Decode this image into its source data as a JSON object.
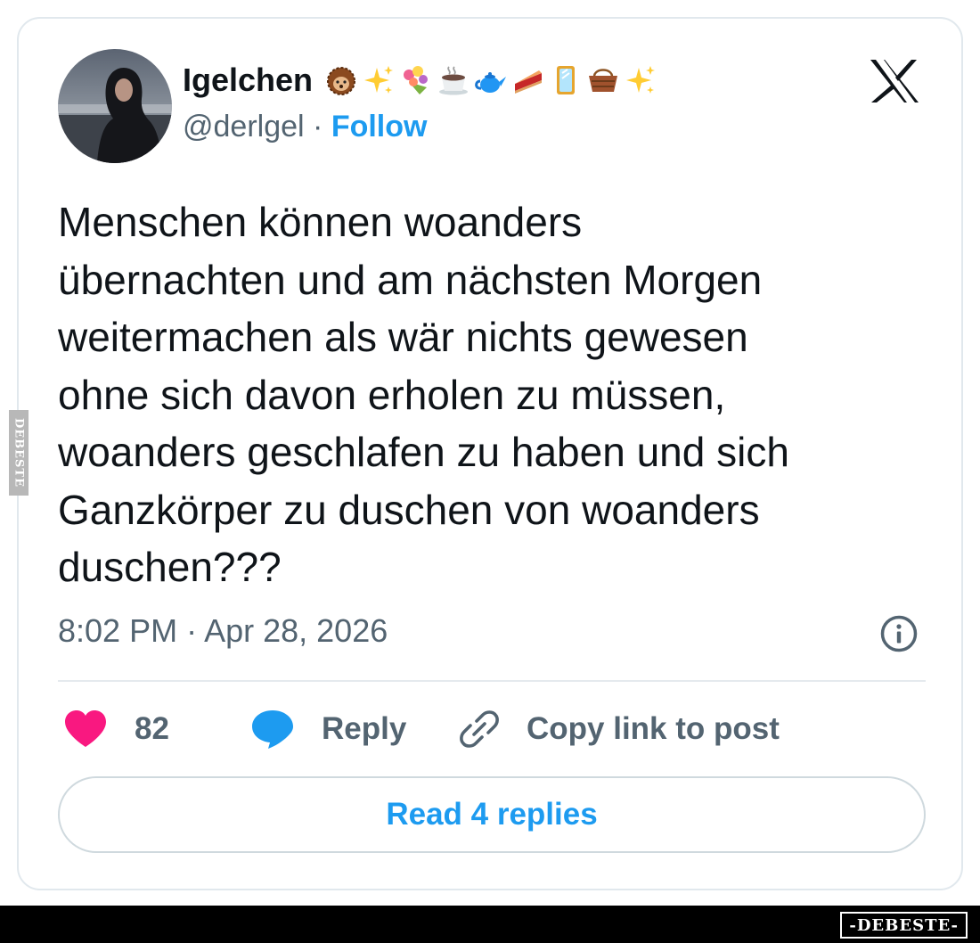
{
  "post": {
    "author": {
      "display_name": "Igelchen",
      "name_emojis": [
        "hedgehog-emoji",
        "sparkles-emoji",
        "bouquet-emoji",
        "hot-beverage-emoji",
        "teapot-emoji",
        "pie-emoji",
        "mirror-emoji",
        "basket-emoji",
        "sparkles-emoji"
      ],
      "handle": "@derlgel",
      "separator": "·",
      "follow_label": "Follow"
    },
    "text_lines": [
      "Menschen können woanders",
      "übernachten und am nächsten Morgen",
      "weitermachen als wär nichts gewesen",
      "ohne sich davon erholen zu müssen,",
      "woanders geschlafen zu haben und sich",
      "Ganzkörper zu duschen von woanders",
      "duschen???"
    ],
    "timestamp": "8:02 PM · Apr 28, 2026"
  },
  "actions": {
    "like_count": "82",
    "reply_label": "Reply",
    "copy_link_label": "Copy link to post"
  },
  "read_replies_label": "Read 4 replies",
  "watermarks": {
    "side": "DEBESTE",
    "bottom": "-DEBESTE-"
  },
  "icons": {
    "brand": "x-logo-icon",
    "info": "info-icon",
    "like": "heart-icon",
    "reply": "speech-bubble-icon",
    "copy": "link-icon"
  },
  "colors": {
    "accent": "#1d9bf0",
    "like": "#f91880",
    "text_primary": "#0f1419",
    "text_secondary": "#536471",
    "border": "#e1e8ed"
  }
}
